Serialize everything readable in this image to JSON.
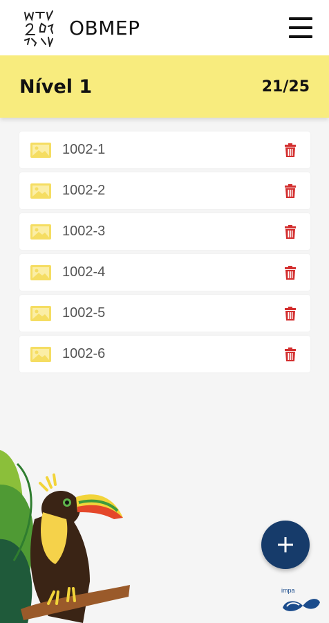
{
  "app": {
    "title": "OBMEP"
  },
  "level": {
    "title": "Nível 1",
    "count": "21/25"
  },
  "items": [
    {
      "label": "1002-1"
    },
    {
      "label": "1002-2"
    },
    {
      "label": "1002-3"
    },
    {
      "label": "1002-4"
    },
    {
      "label": "1002-5"
    },
    {
      "label": "1002-6"
    }
  ],
  "footer": {
    "impa_label": "impa"
  },
  "colors": {
    "header_yellow": "#f8ec7e",
    "icon_yellow": "#f5dd62",
    "delete_red": "#d32f2f",
    "fab_blue": "#163b6a"
  },
  "icons": {
    "menu": "hamburger-icon",
    "item": "image-icon",
    "delete": "trash-icon",
    "add": "plus-icon"
  }
}
